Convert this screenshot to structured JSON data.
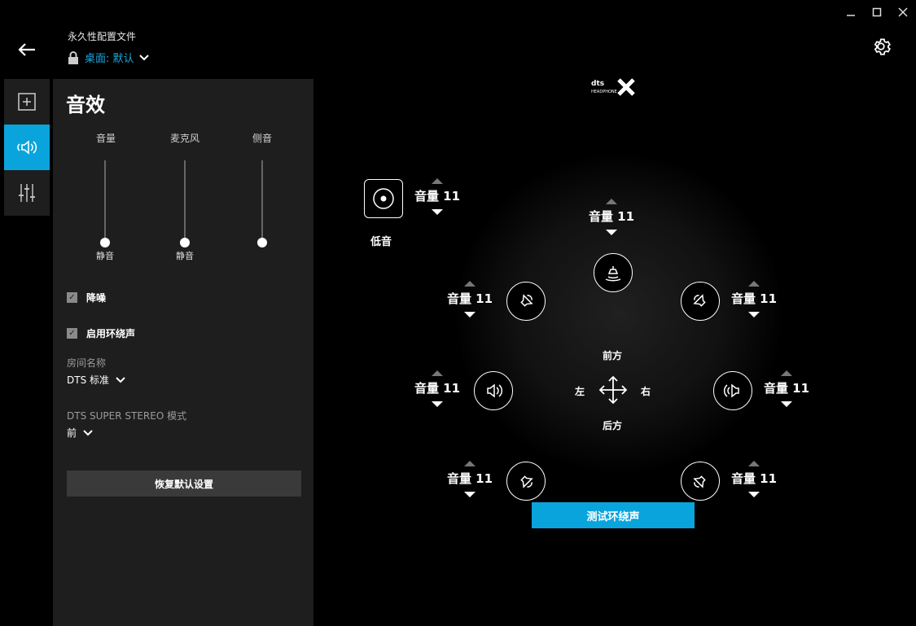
{
  "window": {
    "minimize_icon": "minimize-icon",
    "maximize_icon": "maximize-icon",
    "close_icon": "close-icon"
  },
  "header": {
    "title": "永久性配置文件",
    "profile_label": "桌面: 默认",
    "back_icon": "arrow-left-icon",
    "lock_icon": "lock-icon",
    "settings_icon": "gear-icon"
  },
  "sidenav": {
    "items": [
      {
        "icon": "add-icon",
        "active": false
      },
      {
        "icon": "speaker-icon",
        "active": true
      },
      {
        "icon": "equalizer-icon",
        "active": false
      }
    ]
  },
  "panel": {
    "title": "音效",
    "sliders": [
      {
        "label": "音量",
        "value_text": "静音"
      },
      {
        "label": "麦克风",
        "value_text": "静音"
      },
      {
        "label": "侧音",
        "value_text": ""
      }
    ],
    "noise_reduction": {
      "label": "降噪",
      "checked": true
    },
    "surround": {
      "label": "启用环绕声",
      "checked": true
    },
    "room": {
      "label": "房间名称",
      "value": "DTS 标准"
    },
    "super_stereo": {
      "label": "DTS SUPER STEREO 模式",
      "value": "前"
    },
    "reset_label": "恢复默认设置"
  },
  "surround_view": {
    "logo_text": "dts HEADPHONE X",
    "bass_label": "低音",
    "bass_volume": "音量 11",
    "center_volume": "音量 11",
    "front_left_volume": "音量 11",
    "front_right_volume": "音量 11",
    "side_left_volume": "音量 11",
    "side_right_volume": "音量 11",
    "rear_left_volume": "音量 11",
    "rear_right_volume": "音量 11",
    "front_label": "前方",
    "back_label": "后方",
    "left_label": "左",
    "right_label": "右",
    "test_button": "测试环绕声"
  }
}
